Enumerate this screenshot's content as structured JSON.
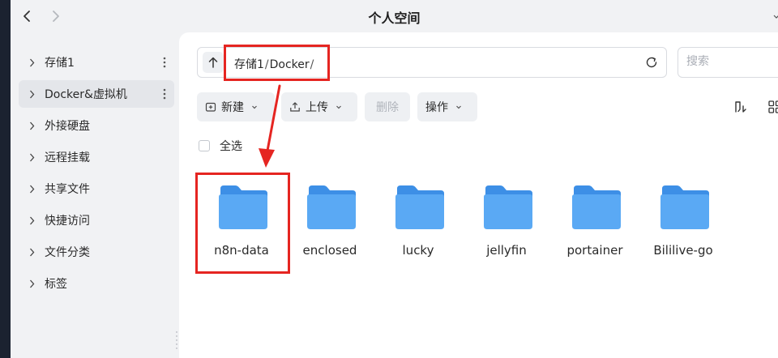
{
  "window": {
    "title": "个人空间"
  },
  "sidebar": {
    "items": [
      {
        "label": "存储1",
        "has_more": true
      },
      {
        "label": "Docker&虚拟机",
        "has_more": true
      },
      {
        "label": "外接硬盘"
      },
      {
        "label": "远程挂载"
      },
      {
        "label": "共享文件"
      },
      {
        "label": "快捷访问"
      },
      {
        "label": "文件分类"
      },
      {
        "label": "标签"
      }
    ]
  },
  "path": {
    "segments": [
      "存储1",
      "Docker"
    ],
    "separator": "/"
  },
  "search": {
    "placeholder": "搜索"
  },
  "toolbar": {
    "new_label": "新建",
    "upload_label": "上传",
    "delete_label": "删除",
    "ops_label": "操作"
  },
  "select_all": {
    "label": "全选"
  },
  "folders": [
    {
      "name": "n8n-data"
    },
    {
      "name": "enclosed"
    },
    {
      "name": "lucky"
    },
    {
      "name": "jellyfin"
    },
    {
      "name": "portainer"
    },
    {
      "name": "Bililive-go"
    }
  ],
  "colors": {
    "accent_red": "#e52521",
    "folder_blue": "#5aa9f4"
  }
}
